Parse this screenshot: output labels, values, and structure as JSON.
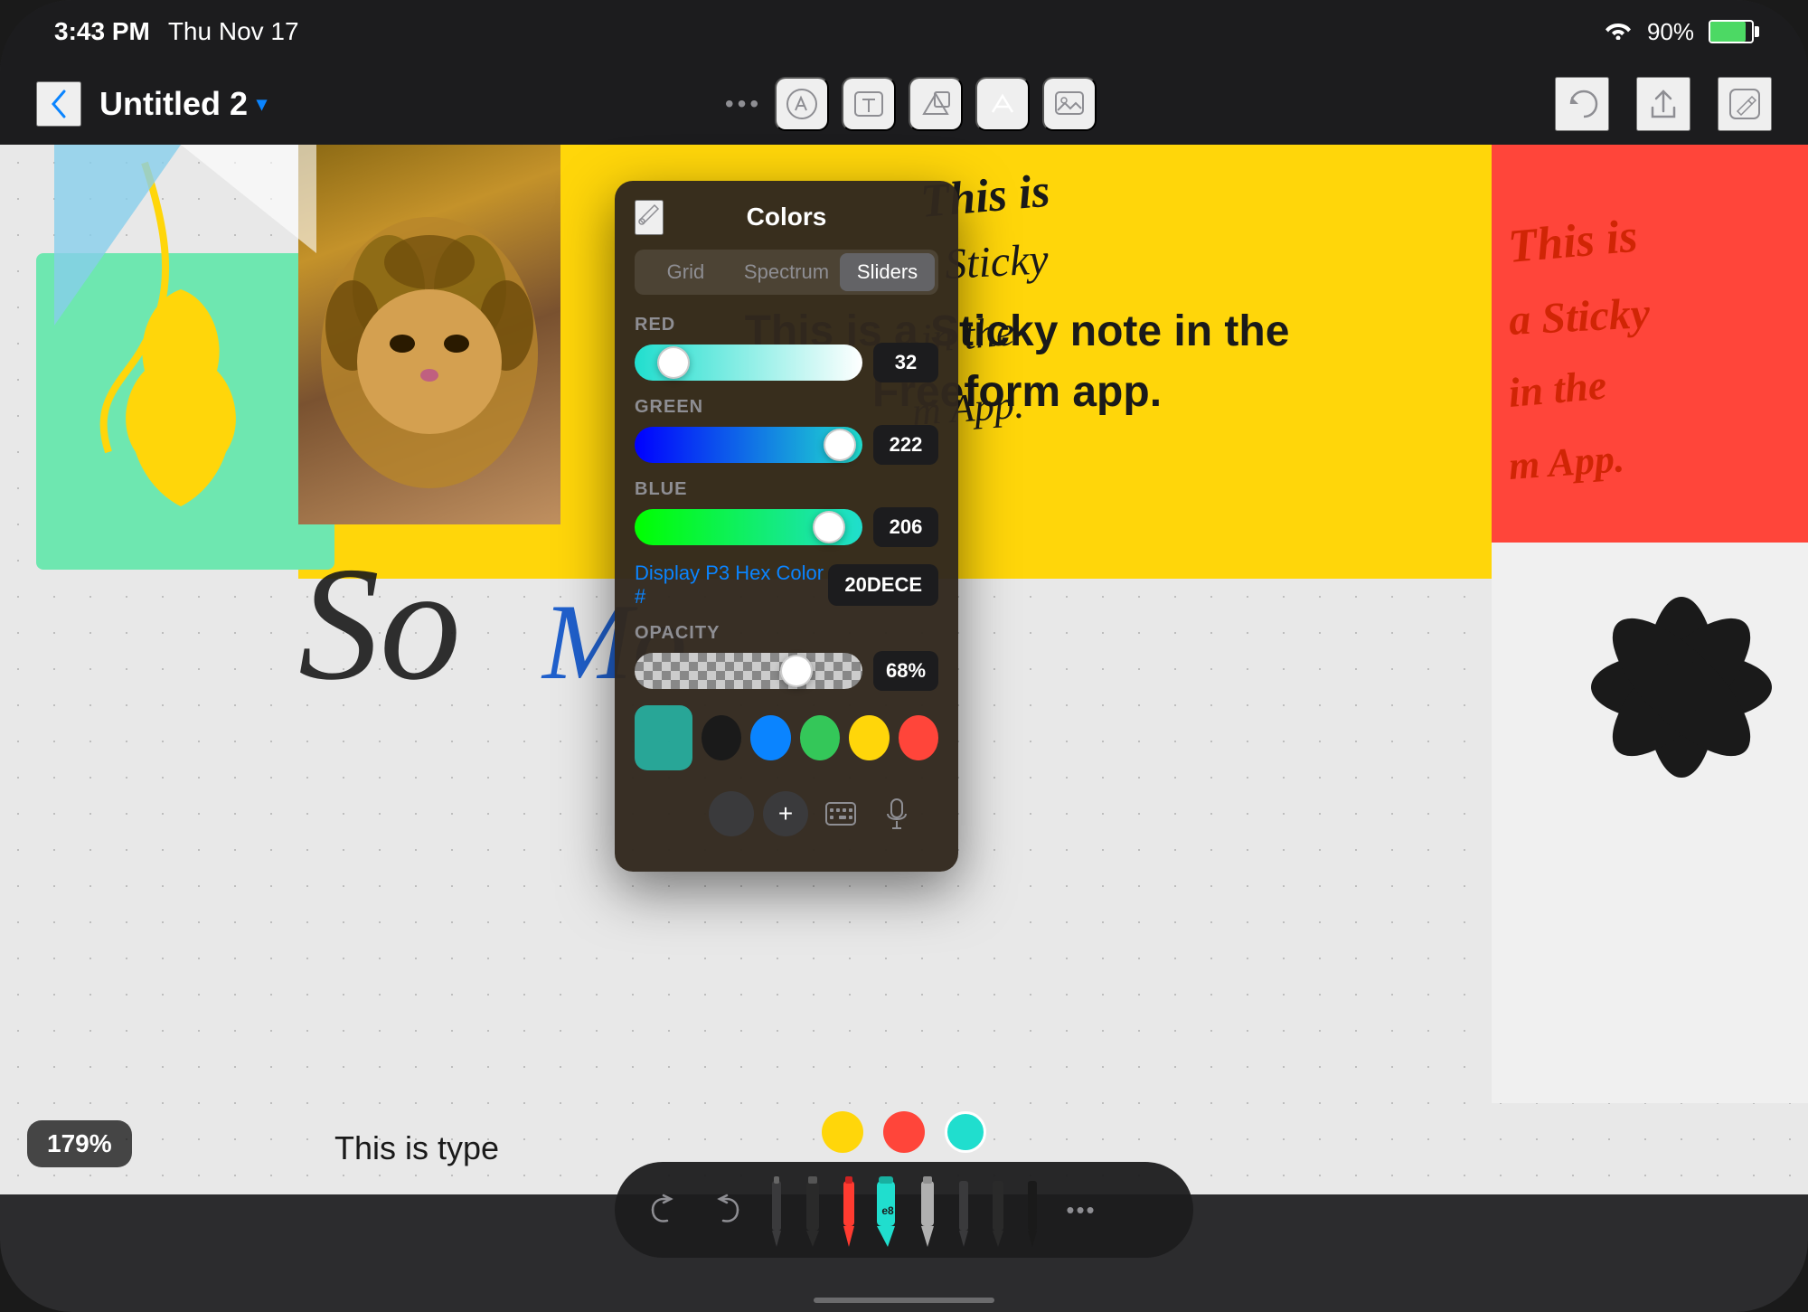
{
  "status_bar": {
    "time": "3:43 PM",
    "date": "Thu Nov 17",
    "wifi": "WiFi",
    "battery_pct": "90%"
  },
  "navbar": {
    "back_label": "‹",
    "title": "Untitled 2",
    "chevron": "▾",
    "dots": "•••",
    "tools": [
      {
        "name": "pen-tool",
        "icon": "✏️"
      },
      {
        "name": "text-tool",
        "icon": "✦"
      },
      {
        "name": "shapes-tool",
        "icon": "⬡"
      },
      {
        "name": "image-tool",
        "icon": "A"
      },
      {
        "name": "media-tool",
        "icon": "⊡"
      }
    ],
    "right_tools": [
      {
        "name": "undo-btn",
        "icon": "↺"
      },
      {
        "name": "share-btn",
        "icon": "⬆"
      },
      {
        "name": "edit-btn",
        "icon": "✎"
      }
    ]
  },
  "canvas": {
    "zoom_label": "179%",
    "sticky_note_text": "This is a Sticky note in the\nFreeform app.",
    "typed_text": "This is type"
  },
  "colors_panel": {
    "title": "Colors",
    "eyedropper_icon": "💧",
    "tabs": [
      {
        "label": "Grid",
        "active": false
      },
      {
        "label": "Spectrum",
        "active": false
      },
      {
        "label": "Sliders",
        "active": true
      }
    ],
    "sliders": [
      {
        "label": "RED",
        "value": "32",
        "thumb_pct": 12,
        "track_type": "red"
      },
      {
        "label": "GREEN",
        "value": "222",
        "thumb_pct": 86,
        "track_type": "green"
      },
      {
        "label": "BLUE",
        "value": "206",
        "thumb_pct": 80,
        "track_type": "blue"
      }
    ],
    "hex_label": "Display P3 Hex Color #",
    "hex_value": "20DECE",
    "opacity_label": "OPACITY",
    "opacity_value": "68%",
    "opacity_thumb_pct": 68,
    "current_color": "rgba(32,222,206,0.68)",
    "color_swatches": [
      {
        "color": "#1a1a1a",
        "name": "black-swatch"
      },
      {
        "color": "#0a84ff",
        "name": "blue-swatch"
      },
      {
        "color": "#34c759",
        "name": "green-swatch"
      },
      {
        "color": "#ffd60a",
        "name": "yellow-swatch"
      },
      {
        "color": "#ff453a",
        "name": "red-swatch"
      }
    ],
    "color_swatches_row2": [
      {
        "color": "#3a3a3c",
        "name": "dark-swatch"
      },
      {
        "color": "add",
        "name": "add-swatch"
      }
    ]
  },
  "bottom_toolbar": {
    "undo_label": "↺",
    "redo_label": "↻",
    "pens": [
      {
        "type": "pen-a",
        "color": "#1a1a1a"
      },
      {
        "type": "pen-b",
        "color": "#1a1a1a"
      },
      {
        "type": "pen-c",
        "color": "#ff453a"
      },
      {
        "type": "pen-d",
        "color": "#20DECE"
      },
      {
        "type": "pen-e",
        "color": "#b0b0b0"
      },
      {
        "type": "pen-f",
        "color": "#1a1a1a"
      },
      {
        "type": "pen-g",
        "color": "#1a1a1a"
      },
      {
        "type": "pen-h",
        "color": "#1a1a1a"
      }
    ],
    "bottom_dots": [
      {
        "color": "#ffd60a",
        "name": "yellow-dot"
      },
      {
        "color": "#ff453a",
        "name": "red-dot"
      },
      {
        "color": "#20DECE",
        "name": "teal-dot"
      }
    ],
    "more_icon": "•••"
  }
}
